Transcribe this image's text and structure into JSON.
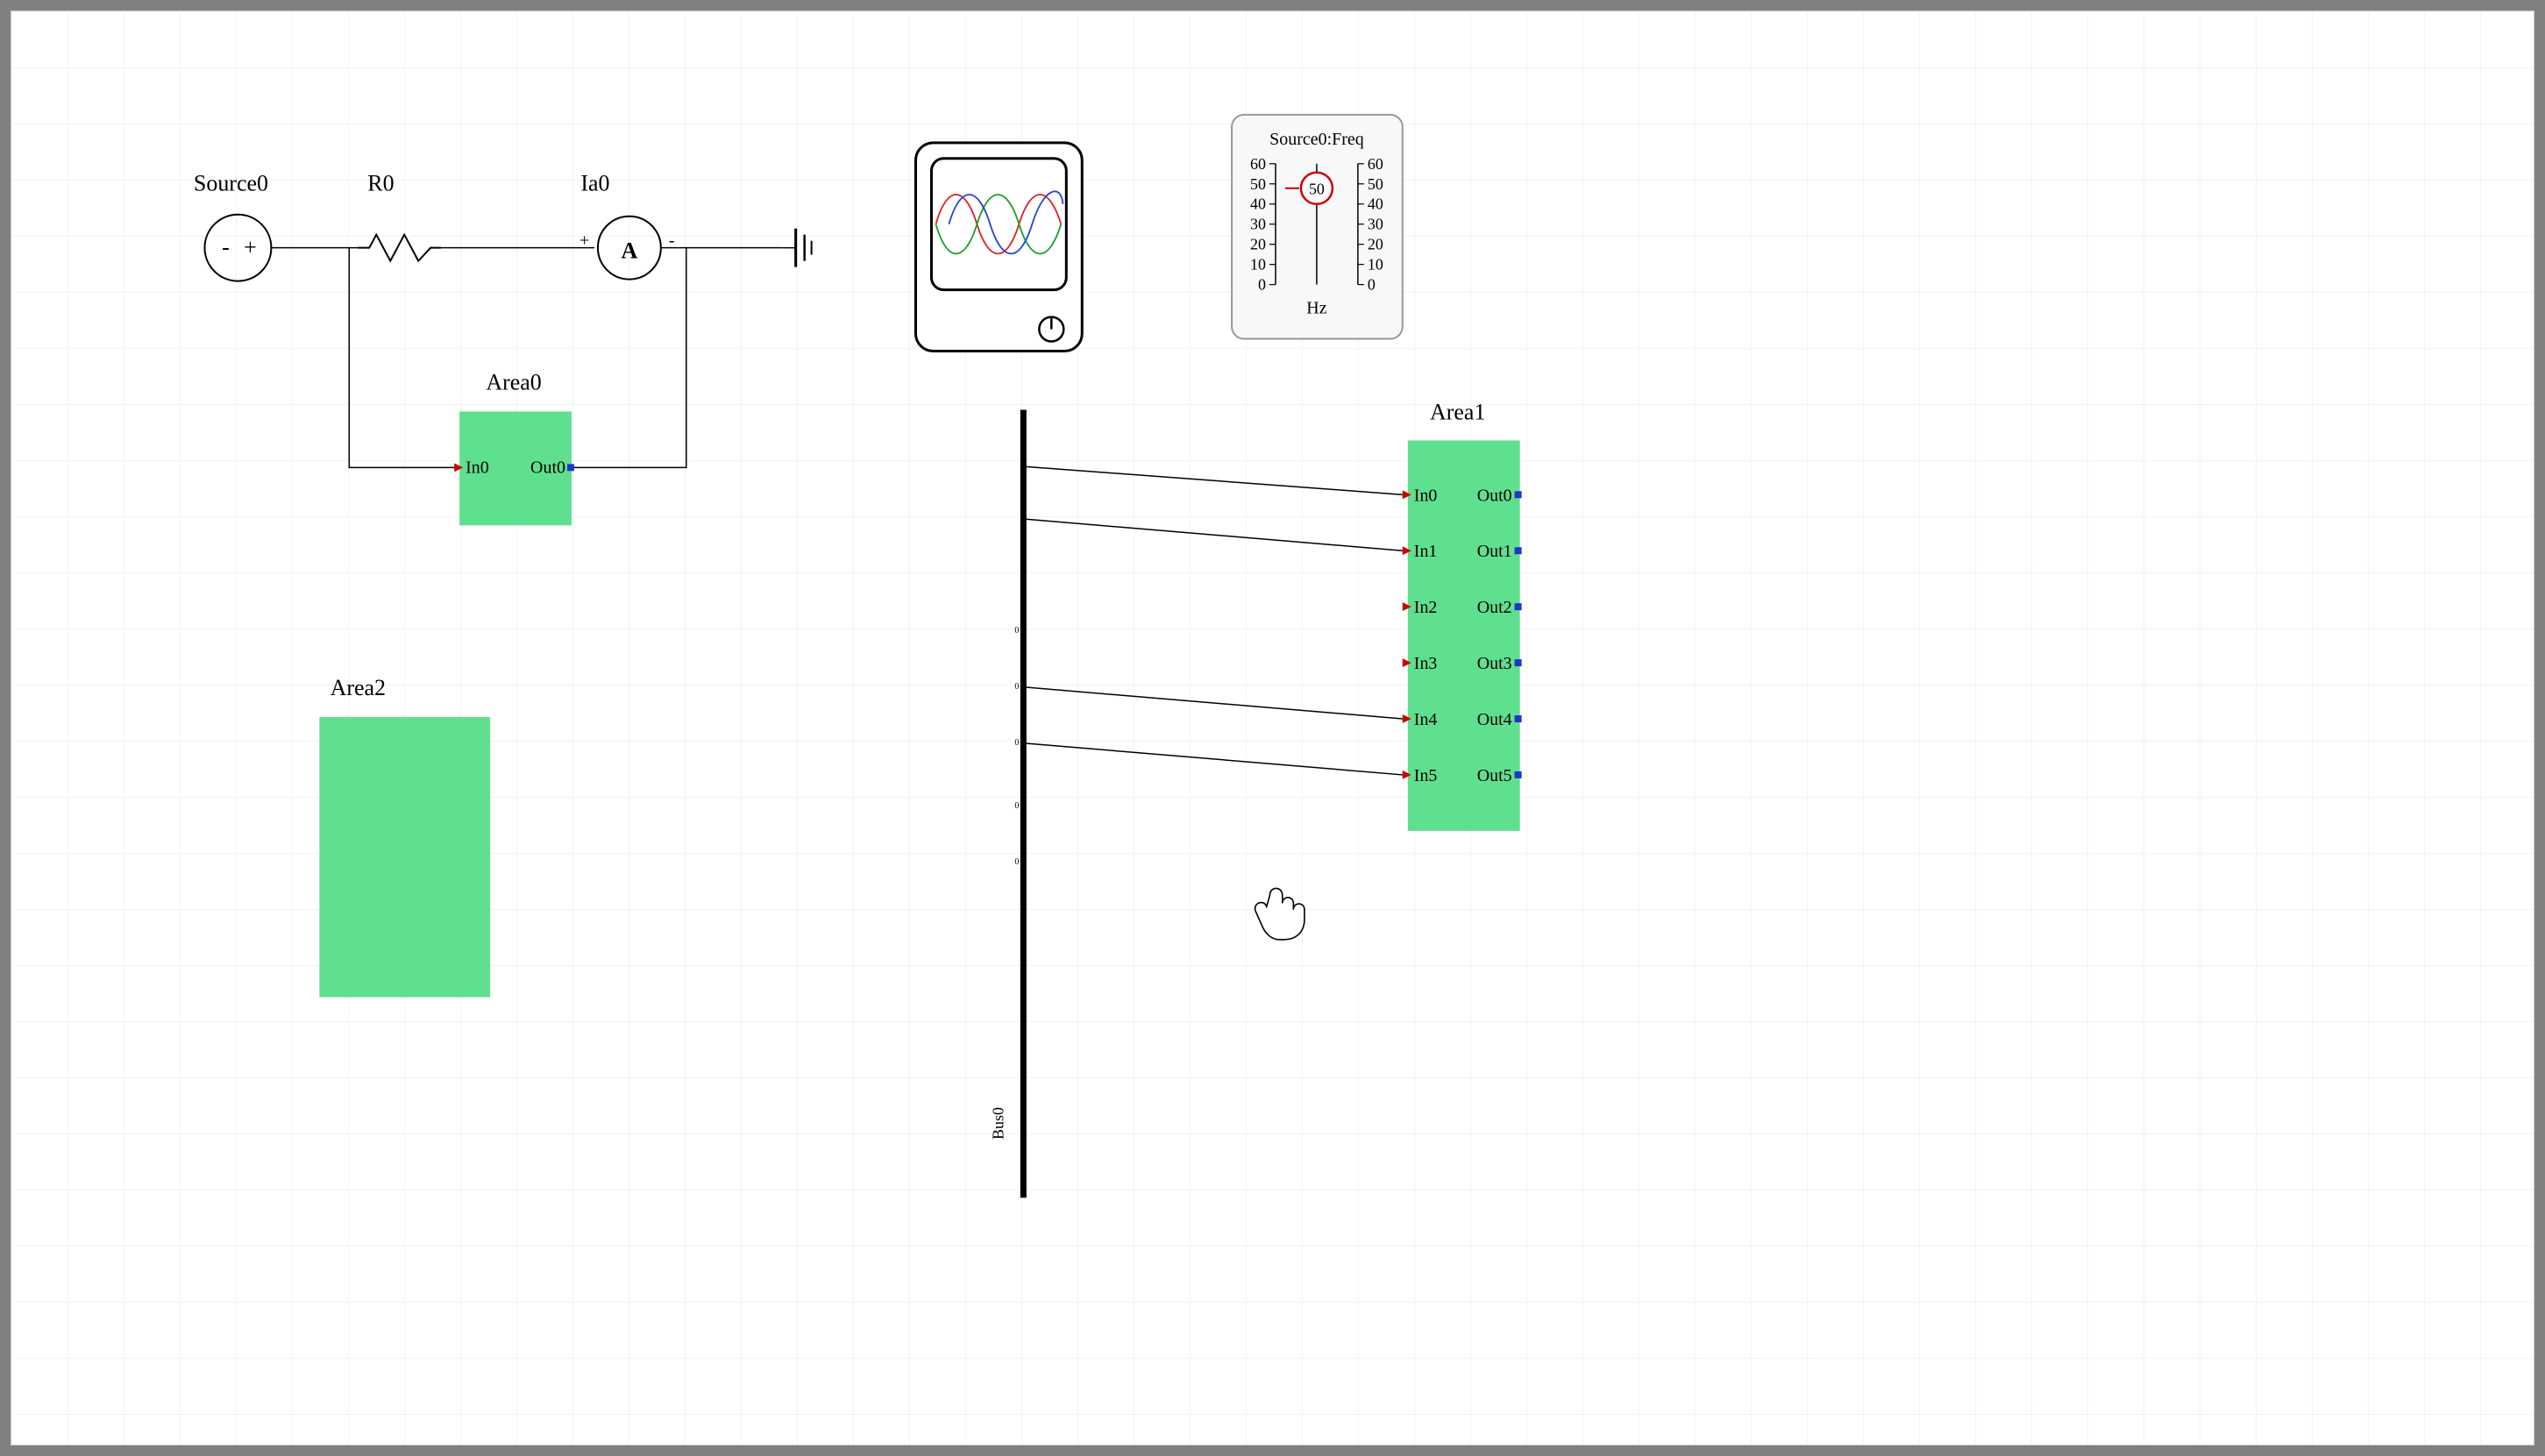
{
  "circuit": {
    "source": {
      "label": "Source0",
      "minus": "-",
      "plus": "+"
    },
    "resistor": {
      "label": "R0"
    },
    "ammeter": {
      "label": "Ia0",
      "symbol": "A",
      "plus": "+",
      "minus": "-"
    }
  },
  "areas": {
    "area0": {
      "label": "Area0",
      "ports_in": [
        "In0"
      ],
      "ports_out": [
        "Out0"
      ]
    },
    "area1": {
      "label": "Area1",
      "ports_in": [
        "In0",
        "In1",
        "In2",
        "In3",
        "In4",
        "In5"
      ],
      "ports_out": [
        "Out0",
        "Out1",
        "Out2",
        "Out3",
        "Out4",
        "Out5"
      ]
    },
    "area2": {
      "label": "Area2"
    }
  },
  "bus": {
    "label": "Bus0"
  },
  "scope": {
    "name": "oscilloscope"
  },
  "slider": {
    "title": "Source0:Freq",
    "unit": "Hz",
    "value": "50",
    "scale_left": [
      "60",
      "50",
      "40",
      "30",
      "20",
      "10",
      "0"
    ],
    "scale_right": [
      "60",
      "50",
      "40",
      "30",
      "20",
      "10",
      "0"
    ]
  }
}
